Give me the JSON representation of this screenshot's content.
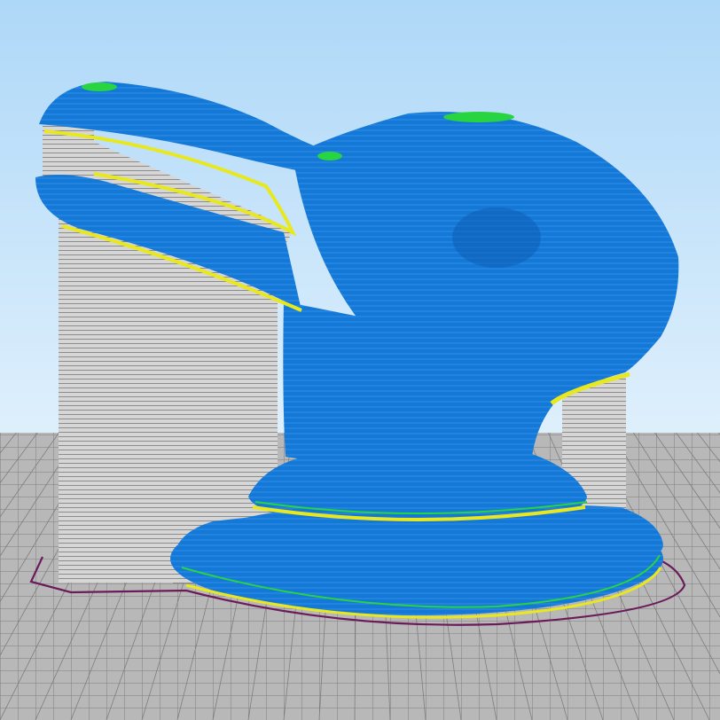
{
  "app": {
    "view": "slicer-layer-preview",
    "model": "rabbit-bust"
  },
  "colors": {
    "sky_top": "#aed8f8",
    "sky_bottom": "#ffffff",
    "bed": "#b8b8b8",
    "grid_line": "#7e7e7e",
    "model_blue": "#1479d6",
    "model_blue_dark": "#0d5fb4",
    "model_line": "#2d8ae6",
    "shell_green": "#29d441",
    "infill_yellow": "#e8e820",
    "support_grey": "#d6d6d6",
    "support_line": "#8c8c8c",
    "skirt_purple": "#6b1b5a"
  }
}
